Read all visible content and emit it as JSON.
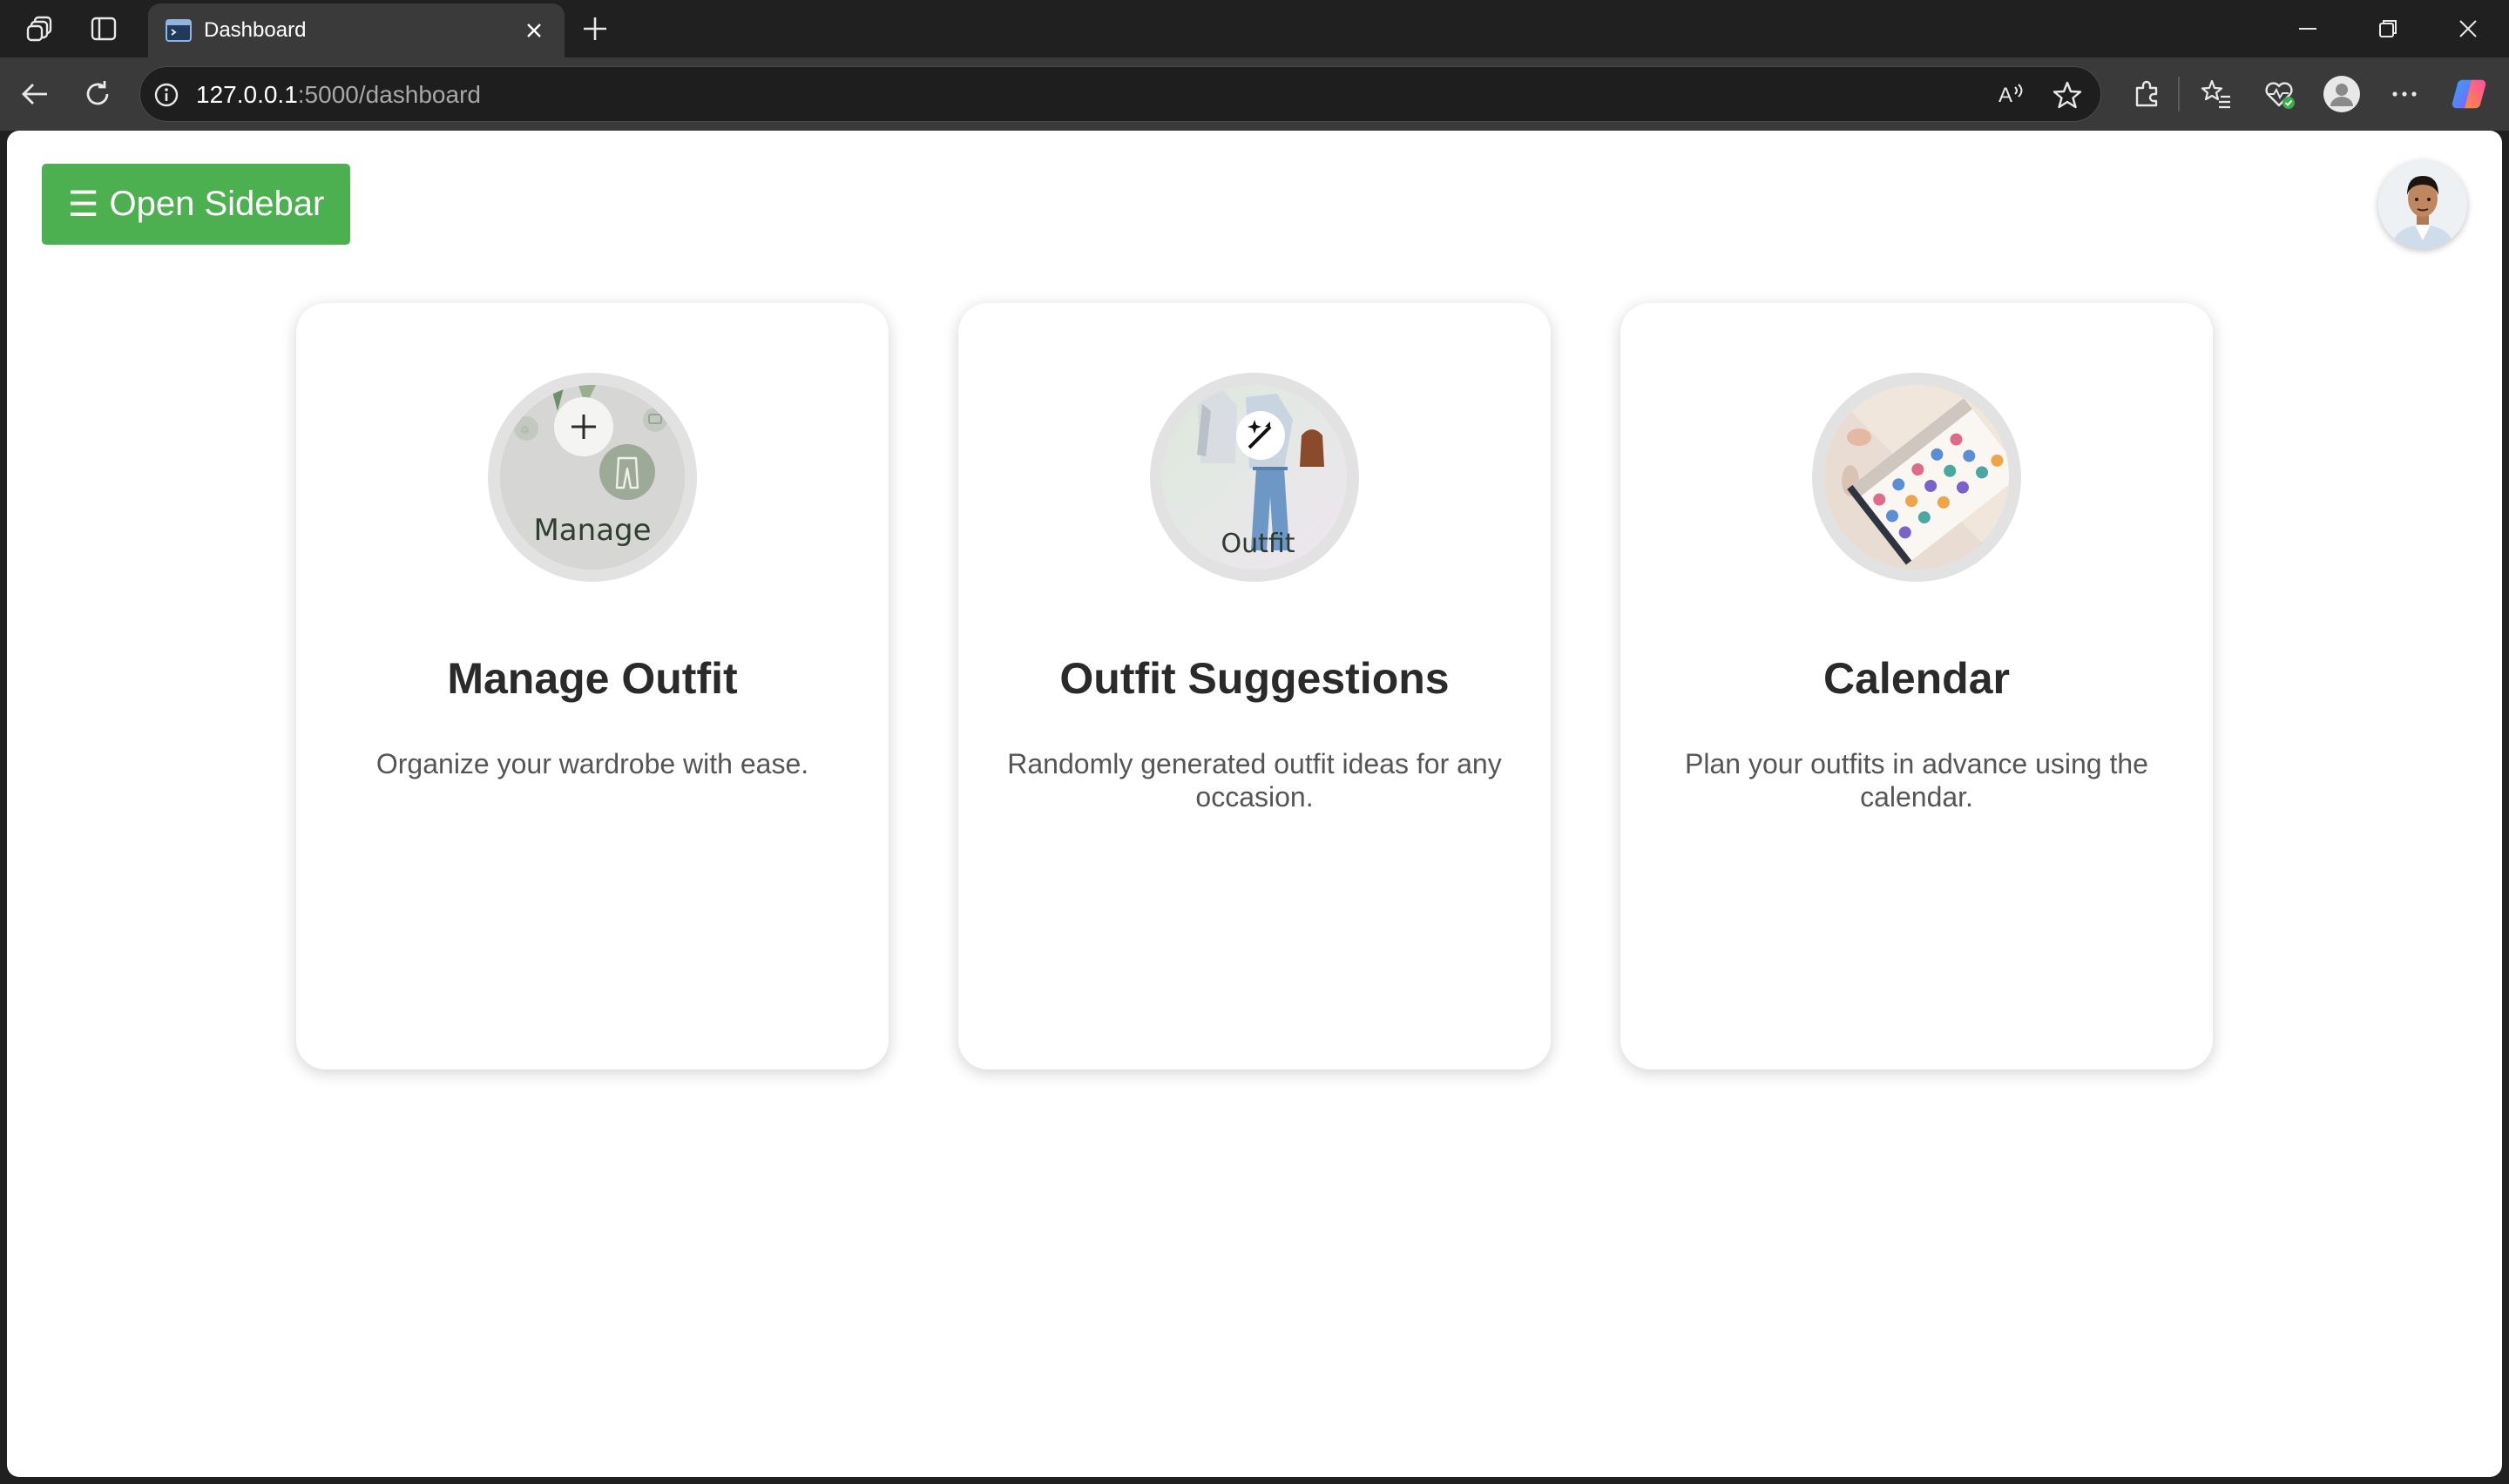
{
  "browser": {
    "tab": {
      "title": "Dashboard"
    },
    "address": {
      "host": "127.0.0.1",
      "path": ":5000/dashboard"
    }
  },
  "page": {
    "sidebar_button": {
      "icon": "☰",
      "label": "Open Sidebar"
    },
    "cards": [
      {
        "title": "Manage Outfit",
        "description": "Organize your wardrobe with ease.",
        "image_text": "Manage",
        "icon": "plus-icon"
      },
      {
        "title": "Outfit Suggestions",
        "description": "Randomly generated outfit ideas for any occasion.",
        "image_text": "Outfit",
        "icon": "magic-wand-icon"
      },
      {
        "title": "Calendar",
        "description": "Plan your outfits in advance using the calendar.",
        "icon": "calendar-image"
      }
    ]
  },
  "colors": {
    "accent": "#4caf50"
  }
}
